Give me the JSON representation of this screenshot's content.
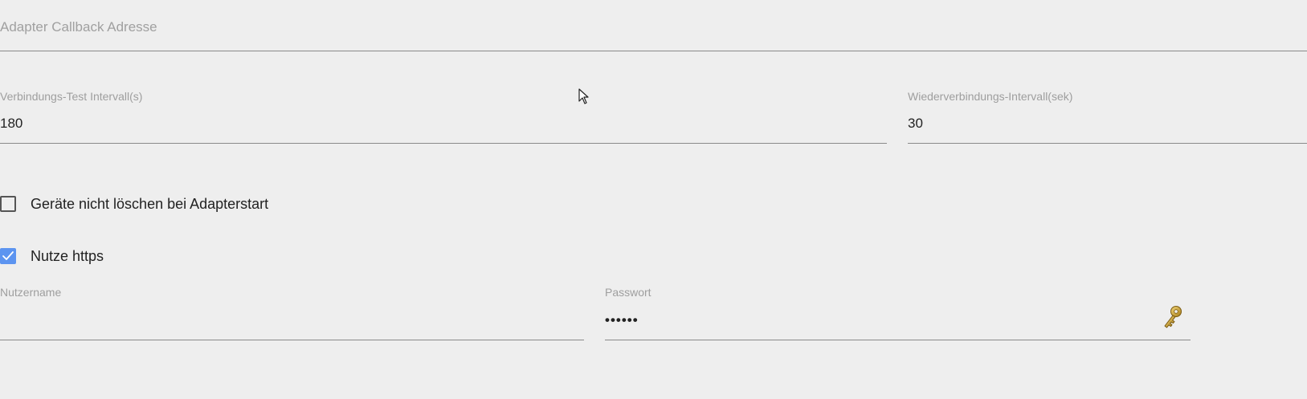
{
  "callback_address": {
    "placeholder": "Adapter Callback Adresse",
    "value": ""
  },
  "connection_test_interval": {
    "label": "Verbindungs-Test Intervall(s)",
    "value": "180"
  },
  "reconnect_interval": {
    "label": "Wiederverbindungs-Intervall(sek)",
    "value": "30"
  },
  "keep_devices_checkbox": {
    "label": "Geräte nicht löschen bei Adapterstart",
    "checked": false
  },
  "use_https_checkbox": {
    "label": "Nutze https",
    "checked": true
  },
  "username": {
    "label": "Nutzername",
    "value": ""
  },
  "password": {
    "label": "Passwort",
    "value": "••••••"
  },
  "icons": {
    "password_reveal": "key-icon",
    "https_check": "checkmark-icon",
    "pointer": "mouse-cursor-icon"
  },
  "colors": {
    "background": "#eeeeee",
    "underline": "#8a8a8a",
    "label": "#9e9e9e",
    "checkbox_checked": "#5c94f0",
    "key": "#c9a227"
  }
}
